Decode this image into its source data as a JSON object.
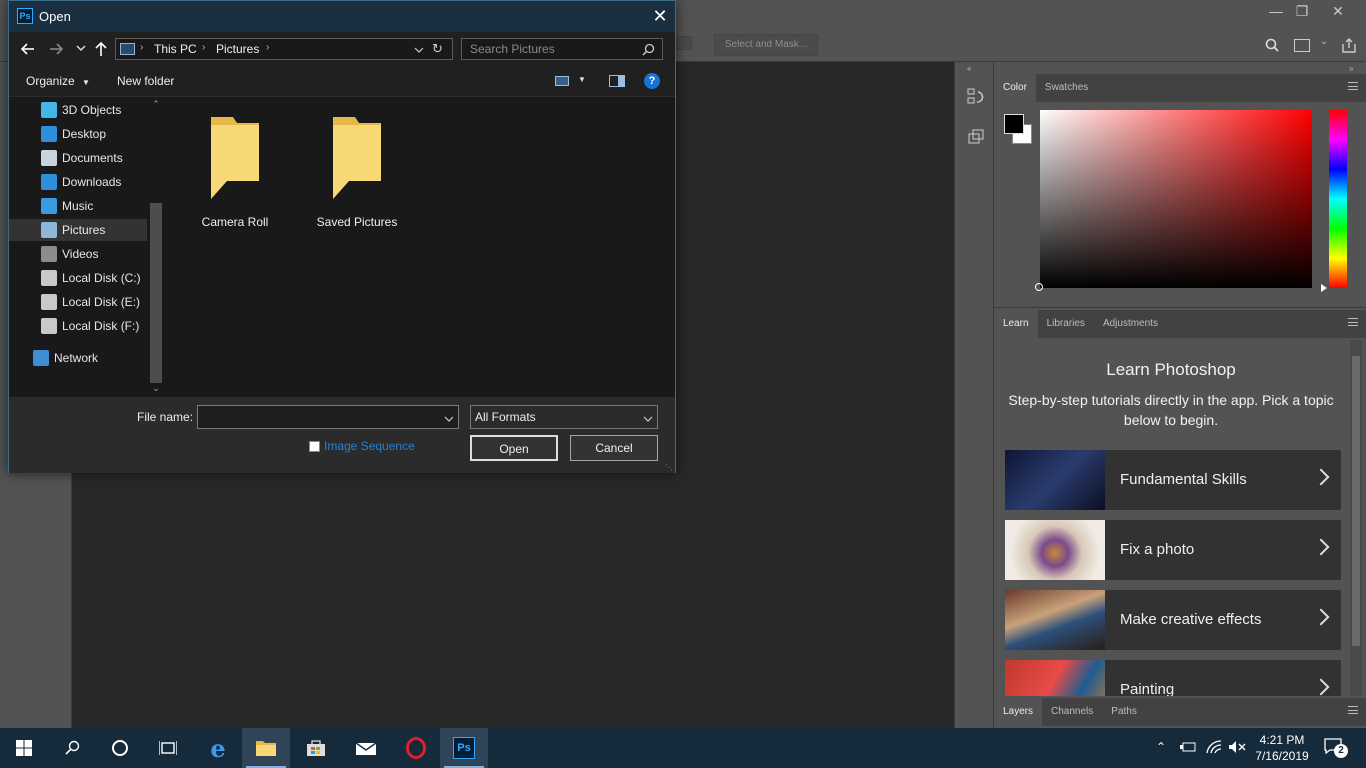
{
  "ps": {
    "select_and_mask": "Select and Mask...",
    "color_panel": {
      "tabs": [
        "Color",
        "Swatches"
      ]
    },
    "learn_panel": {
      "tabs": [
        "Learn",
        "Libraries",
        "Adjustments"
      ],
      "title": "Learn Photoshop",
      "subtitle": "Step-by-step tutorials directly in the app. Pick a topic below to begin.",
      "cards": [
        "Fundamental Skills",
        "Fix a photo",
        "Make creative effects",
        "Painting"
      ]
    },
    "layers_panel": {
      "tabs": [
        "Layers",
        "Channels",
        "Paths"
      ]
    }
  },
  "dialog": {
    "title": "Open",
    "breadcrumb": [
      "This PC",
      "Pictures"
    ],
    "search_placeholder": "Search Pictures",
    "organize": "Organize",
    "new_folder": "New folder",
    "nav_items": [
      {
        "label": "3D Objects",
        "color": "#41b7e8"
      },
      {
        "label": "Desktop",
        "color": "#2d8fd8"
      },
      {
        "label": "Documents",
        "color": "#c9d3dd"
      },
      {
        "label": "Downloads",
        "color": "#2d8fd8"
      },
      {
        "label": "Music",
        "color": "#3b9be0"
      },
      {
        "label": "Pictures",
        "color": "#8fb5d9"
      },
      {
        "label": "Videos",
        "color": "#8c8c8c"
      },
      {
        "label": "Local Disk (C:)",
        "color": "#c9c9c9"
      },
      {
        "label": "Local Disk (E:)",
        "color": "#c9c9c9"
      },
      {
        "label": "Local Disk (F:)",
        "color": "#c9c9c9"
      },
      {
        "label": "Network",
        "color": "#3a8fd6"
      }
    ],
    "selected_nav": "Pictures",
    "folders": [
      "Camera Roll",
      "Saved Pictures"
    ],
    "file_name_label": "File name:",
    "file_name_value": "",
    "format": "All Formats",
    "image_sequence": "Image Sequence",
    "open": "Open",
    "cancel": "Cancel"
  },
  "taskbar": {
    "time": "4:21 PM",
    "date": "7/16/2019",
    "notifications": "2"
  }
}
